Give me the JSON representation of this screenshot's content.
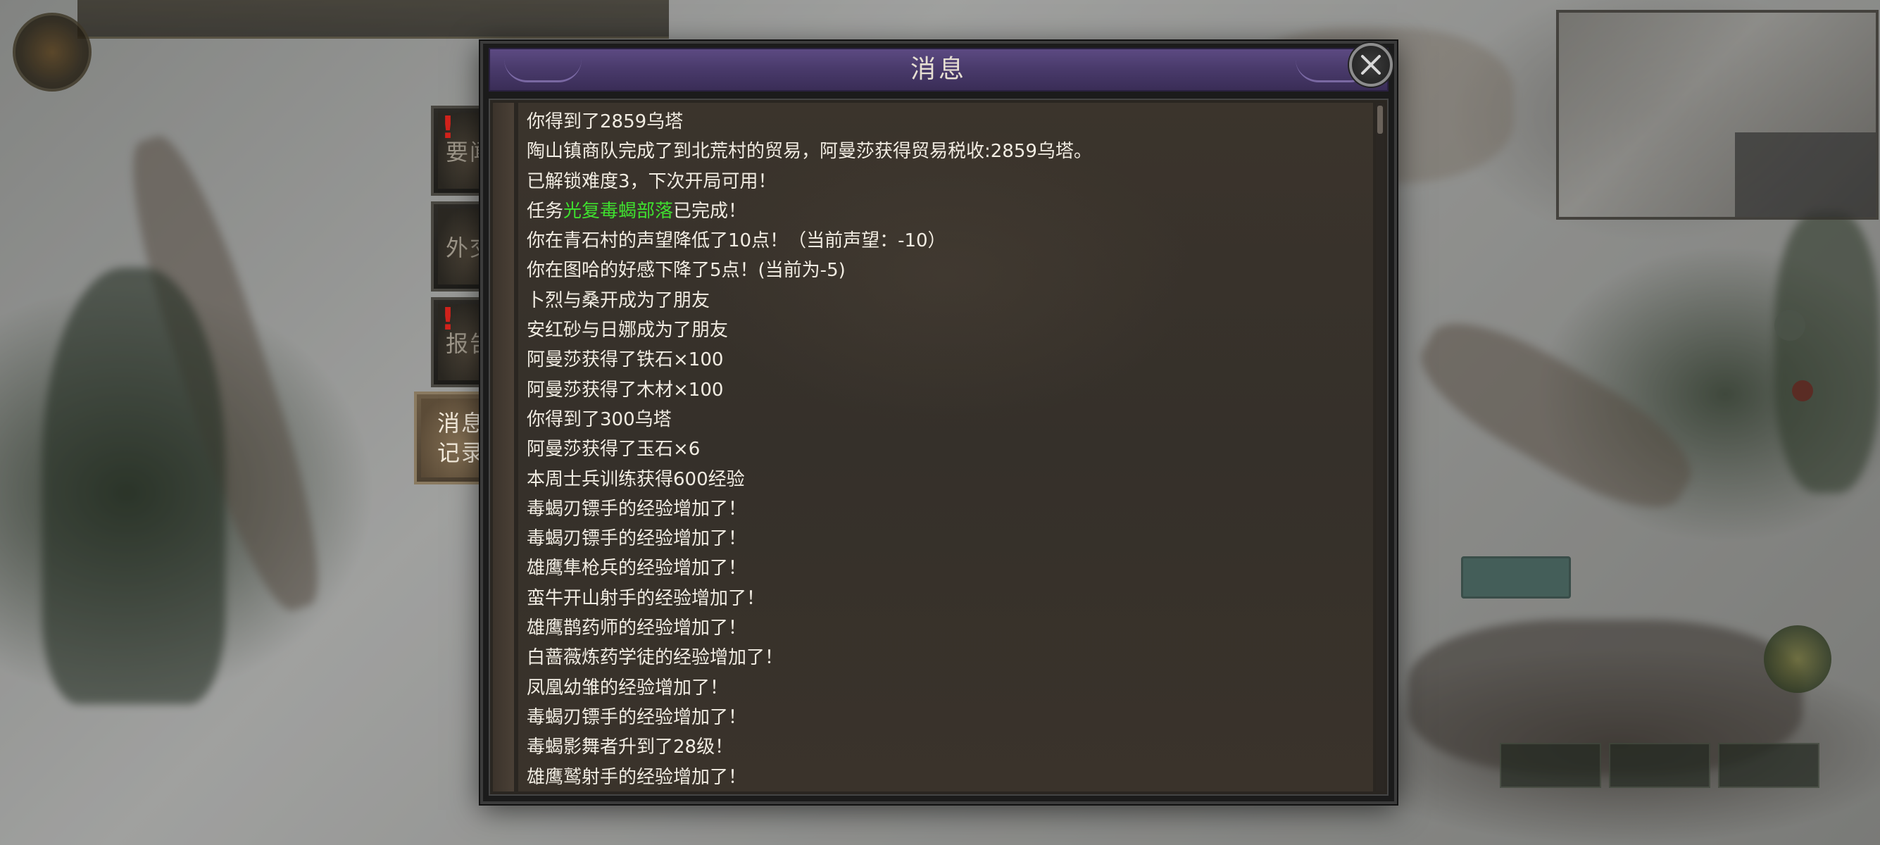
{
  "window": {
    "title": "消息",
    "close_icon": "close-icon"
  },
  "tabs": [
    {
      "label": "要闻",
      "alert": "!",
      "active": false
    },
    {
      "label": "外交",
      "alert": "",
      "active": false
    },
    {
      "label": "报告",
      "alert": "!",
      "active": false
    },
    {
      "label_line1": "消息",
      "label_line2": "记录",
      "active": true
    }
  ],
  "messages": [
    {
      "text": "你得到了2859乌塔"
    },
    {
      "text": "陶山镇商队完成了到北荒村的贸易，阿曼莎获得贸易税收:2859乌塔。"
    },
    {
      "text": "已解锁难度3，下次开局可用！"
    },
    {
      "prefix": "任务",
      "highlight": "光复毒蝎部落",
      "suffix": "已完成！"
    },
    {
      "text": "你在青石村的声望降低了10点！（当前声望：-10）"
    },
    {
      "text": "你在图哈的好感下降了5点！(当前为-5)"
    },
    {
      "text": "卜烈与桑开成为了朋友"
    },
    {
      "text": "安红砂与日娜成为了朋友"
    },
    {
      "text": "阿曼莎获得了铁石×100"
    },
    {
      "text": "阿曼莎获得了木材×100"
    },
    {
      "text": "你得到了300乌塔"
    },
    {
      "text": "阿曼莎获得了玉石×6"
    },
    {
      "text": "本周士兵训练获得600经验"
    },
    {
      "text": "毒蝎刃镖手的经验增加了！"
    },
    {
      "text": "毒蝎刃镖手的经验增加了！"
    },
    {
      "text": "雄鹰隼枪兵的经验增加了！"
    },
    {
      "text": "蛮牛开山射手的经验增加了！"
    },
    {
      "text": "雄鹰鹊药师的经验增加了！"
    },
    {
      "text": "白蔷薇炼药学徒的经验增加了！"
    },
    {
      "text": "凤凰幼雏的经验增加了！"
    },
    {
      "text": "毒蝎刃镖手的经验增加了！"
    },
    {
      "text": "毒蝎影舞者升到了28级！"
    },
    {
      "text": "雄鹰鹫射手的经验增加了！"
    }
  ],
  "colors": {
    "title_bar": "#4a3b6c",
    "highlight_text": "#3fe02f",
    "alert": "#d2231c",
    "message_text": "#f1ece2"
  }
}
